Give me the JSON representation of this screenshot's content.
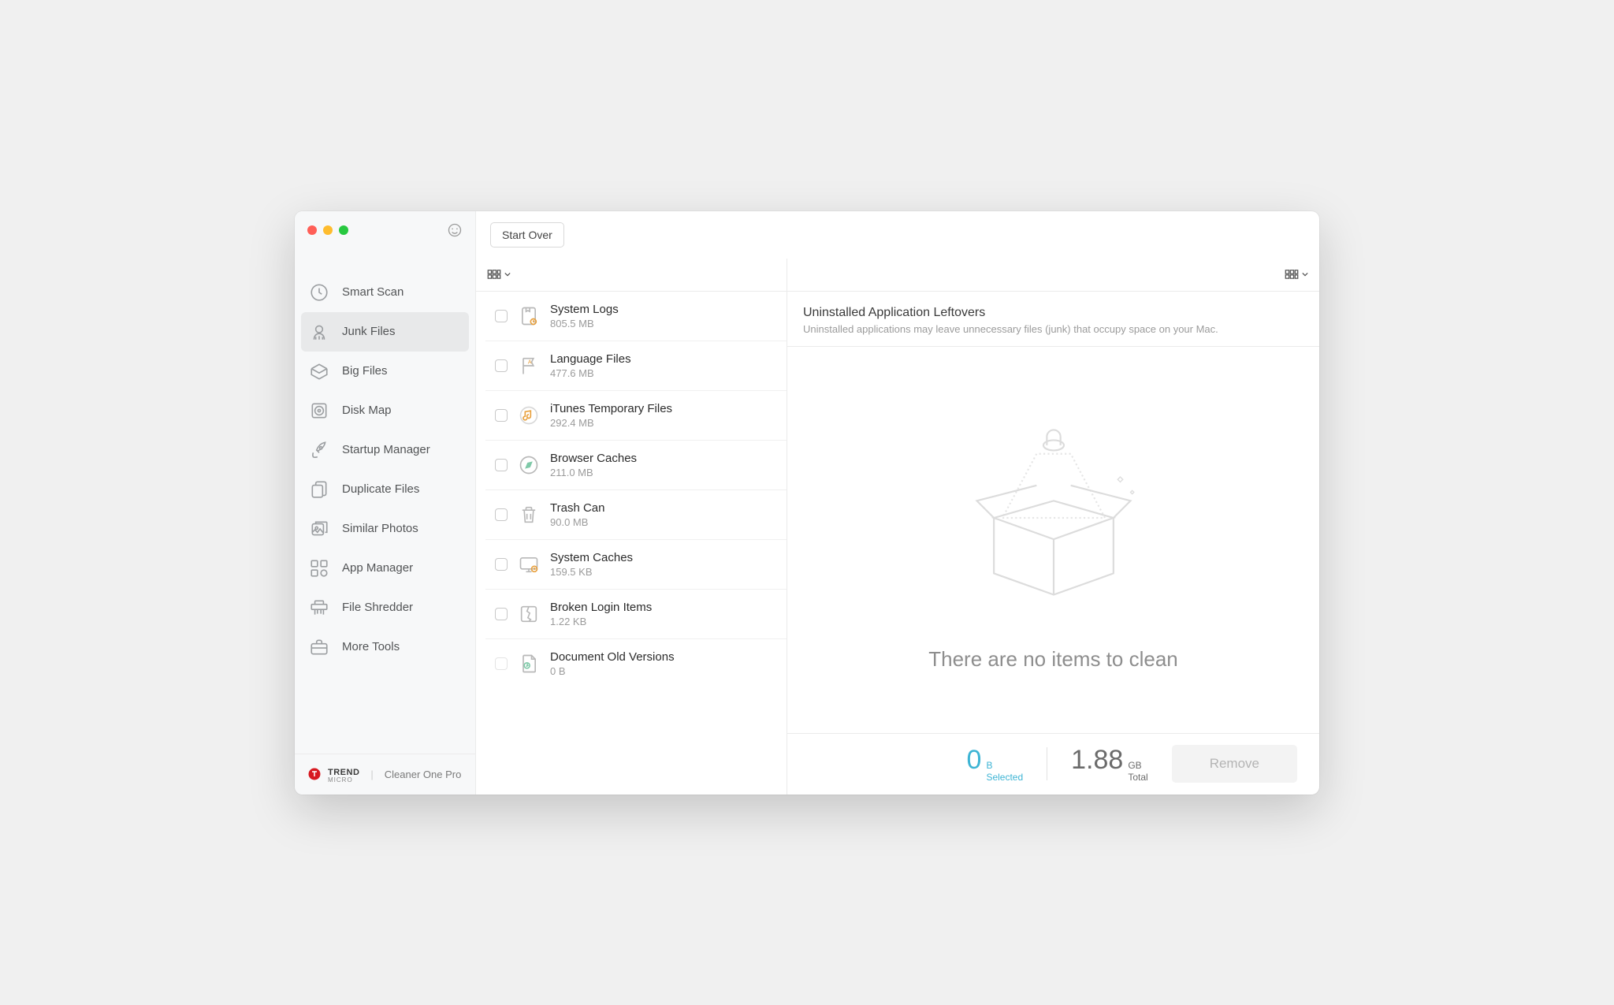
{
  "app": {
    "brand_name": "TREND",
    "brand_sub": "MICRO",
    "name": "Cleaner One Pro"
  },
  "toolbar": {
    "start_over": "Start Over"
  },
  "sidebar": {
    "items": [
      {
        "label": "Smart Scan",
        "icon": "clock-icon"
      },
      {
        "label": "Junk Files",
        "icon": "broom-icon"
      },
      {
        "label": "Big Files",
        "icon": "box-icon"
      },
      {
        "label": "Disk Map",
        "icon": "disk-icon"
      },
      {
        "label": "Startup Manager",
        "icon": "rocket-icon"
      },
      {
        "label": "Duplicate Files",
        "icon": "duplicate-icon"
      },
      {
        "label": "Similar Photos",
        "icon": "photos-icon"
      },
      {
        "label": "App Manager",
        "icon": "apps-icon"
      },
      {
        "label": "File Shredder",
        "icon": "shredder-icon"
      },
      {
        "label": "More Tools",
        "icon": "briefcase-icon"
      }
    ],
    "active_index": 1
  },
  "categories": [
    {
      "title": "System Logs",
      "size": "805.5 MB",
      "icon": "log-icon"
    },
    {
      "title": "Language Files",
      "size": "477.6 MB",
      "icon": "flag-icon"
    },
    {
      "title": "iTunes Temporary Files",
      "size": "292.4 MB",
      "icon": "music-icon"
    },
    {
      "title": "Browser Caches",
      "size": "211.0 MB",
      "icon": "compass-icon"
    },
    {
      "title": "Trash Can",
      "size": "90.0 MB",
      "icon": "trash-icon"
    },
    {
      "title": "System Caches",
      "size": "159.5 KB",
      "icon": "monitor-icon"
    },
    {
      "title": "Broken Login Items",
      "size": "1.22 KB",
      "icon": "broken-icon"
    },
    {
      "title": "Document Old Versions",
      "size": "0 B",
      "icon": "doc-icon",
      "disabled": true
    }
  ],
  "detail": {
    "title": "Uninstalled Application Leftovers",
    "description": "Uninstalled applications may leave unnecessary files (junk) that occupy space on your Mac.",
    "empty_text": "There are no items to clean"
  },
  "footer": {
    "selected_value": "0",
    "selected_unit": "B",
    "selected_label": "Selected",
    "total_value": "1.88",
    "total_unit": "GB",
    "total_label": "Total",
    "remove_label": "Remove"
  }
}
